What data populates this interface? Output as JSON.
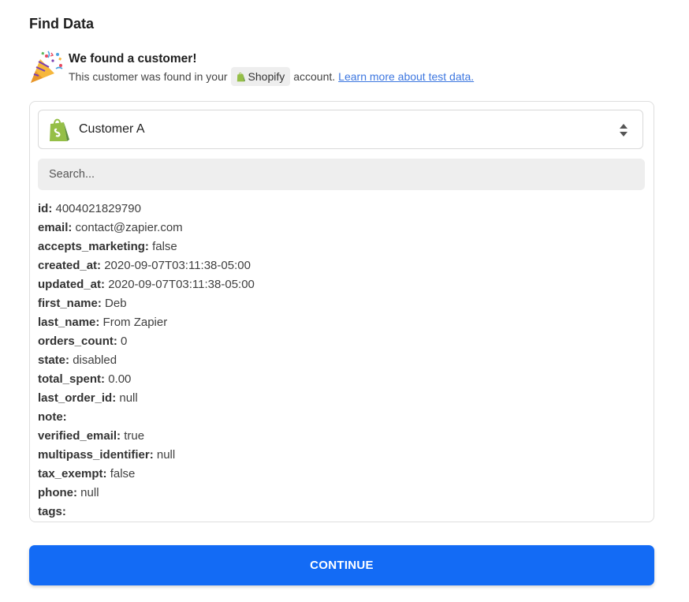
{
  "page": {
    "title": "Find Data"
  },
  "found": {
    "title": "We found a customer!",
    "sub_before": "This customer was found in your",
    "app_name": "Shopify",
    "sub_after": "account.",
    "learn_more": "Learn more about test data.",
    "icon": "party-popper-icon"
  },
  "selector": {
    "value": "Customer A",
    "icon": "shopify-icon"
  },
  "search": {
    "placeholder": "Search..."
  },
  "fields": [
    {
      "key": "id:",
      "value": "4004021829790"
    },
    {
      "key": "email:",
      "value": "contact@zapier.com"
    },
    {
      "key": "accepts_marketing:",
      "value": "false"
    },
    {
      "key": "created_at:",
      "value": "2020-09-07T03:11:38-05:00"
    },
    {
      "key": "updated_at:",
      "value": "2020-09-07T03:11:38-05:00"
    },
    {
      "key": "first_name:",
      "value": "Deb"
    },
    {
      "key": "last_name:",
      "value": "From Zapier"
    },
    {
      "key": "orders_count:",
      "value": "0"
    },
    {
      "key": "state:",
      "value": "disabled"
    },
    {
      "key": "total_spent:",
      "value": "0.00"
    },
    {
      "key": "last_order_id:",
      "value": "null"
    },
    {
      "key": "note:",
      "value": ""
    },
    {
      "key": "verified_email:",
      "value": "true"
    },
    {
      "key": "multipass_identifier:",
      "value": "null"
    },
    {
      "key": "tax_exempt:",
      "value": "false"
    },
    {
      "key": "phone:",
      "value": "null"
    },
    {
      "key": "tags:",
      "value": ""
    }
  ],
  "continue_label": "CONTINUE",
  "colors": {
    "primary": "#136bf5",
    "link": "#3d77e0",
    "shopify_green": "#95bf47"
  }
}
